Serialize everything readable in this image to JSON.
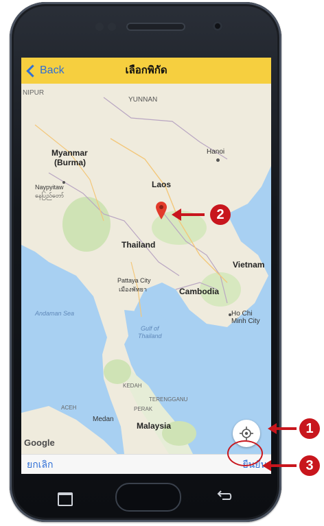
{
  "nav": {
    "back_label": "Back",
    "title": "เลือกพิกัด"
  },
  "map": {
    "labels": {
      "nipur": "NIPUR",
      "yunnan": "YUNNAN",
      "myanmar": "Myanmar",
      "burma": "(Burma)",
      "hanoi": "Hanoi",
      "naypyitaw": "Naypyitaw",
      "naypyitaw_local": "နေပြည်တော်",
      "laos": "Laos",
      "thailand": "Thailand",
      "vietnam": "Vietnam",
      "pattaya": "Pattaya City",
      "pattaya_local": "เมืองพัทยา",
      "cambodia": "Cambodia",
      "andaman": "Andaman Sea",
      "hochiminh": "Ho Chi",
      "hochiminh2": "Minh City",
      "gulf": "Gulf of",
      "gulf2": "Thailand",
      "kedah": "KEDAH",
      "terengganu": "TERENGGANU",
      "perak": "PERAK",
      "aceh": "ACEH",
      "medan": "Medan",
      "malaysia": "Malaysia"
    },
    "attribution": "Google",
    "locate_icon": "crosshair-icon",
    "pin_icon": "map-pin-icon"
  },
  "bottom": {
    "cancel_label": "ยกเลิก",
    "confirm_label": "ยืนยัน"
  },
  "callouts": [
    "1",
    "2",
    "3"
  ],
  "colors": {
    "nav_bg": "#f6cf3f",
    "link": "#2f6fd6",
    "callout": "#c8161d",
    "water": "#a8d0f2",
    "land": "#efebdd"
  }
}
